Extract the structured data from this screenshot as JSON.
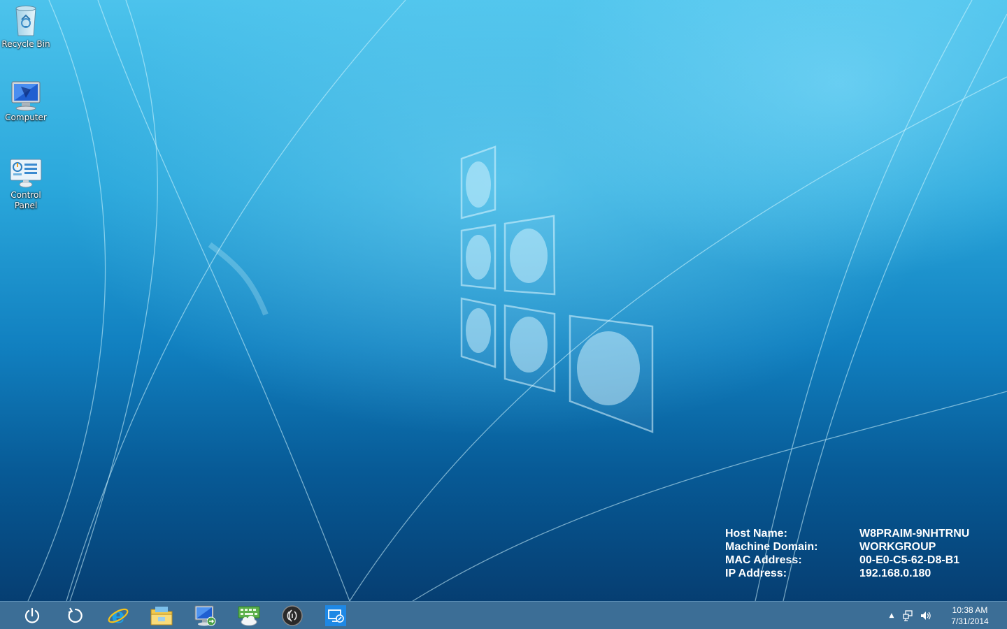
{
  "desktop": {
    "icons": [
      {
        "label": "Recycle Bin",
        "icon": "recycle-bin-icon"
      },
      {
        "label": "Computer",
        "icon": "computer-icon"
      },
      {
        "label": "Control Panel",
        "icon": "control-panel-icon"
      }
    ]
  },
  "bginfo": {
    "rows": [
      {
        "key": "Host Name:",
        "value": "W8PRAIM-9NHTRNU"
      },
      {
        "key": "Machine Domain:",
        "value": "WORKGROUP"
      },
      {
        "key": "MAC Address:",
        "value": "00-E0-C5-62-D8-B1"
      },
      {
        "key": "IP Address:",
        "value": "192.168.0.180"
      }
    ]
  },
  "taskbar": {
    "buttons": [
      {
        "icon": "power-icon"
      },
      {
        "icon": "refresh-icon"
      },
      {
        "icon": "internet-explorer-icon"
      },
      {
        "icon": "file-explorer-icon"
      },
      {
        "icon": "remote-desktop-icon"
      },
      {
        "icon": "keyboard-cloud-icon"
      },
      {
        "icon": "nfc-wireless-icon"
      },
      {
        "icon": "display-settings-icon"
      }
    ],
    "tray": {
      "show_hidden_glyph": "▲",
      "icons": [
        "network-icon",
        "volume-icon"
      ]
    },
    "clock": {
      "time": "10:38 AM",
      "date": "7/31/2014"
    }
  },
  "colors": {
    "taskbar": "#3c6e96",
    "wallpaper_top": "#4cc3ec",
    "wallpaper_bottom": "#05386a"
  }
}
